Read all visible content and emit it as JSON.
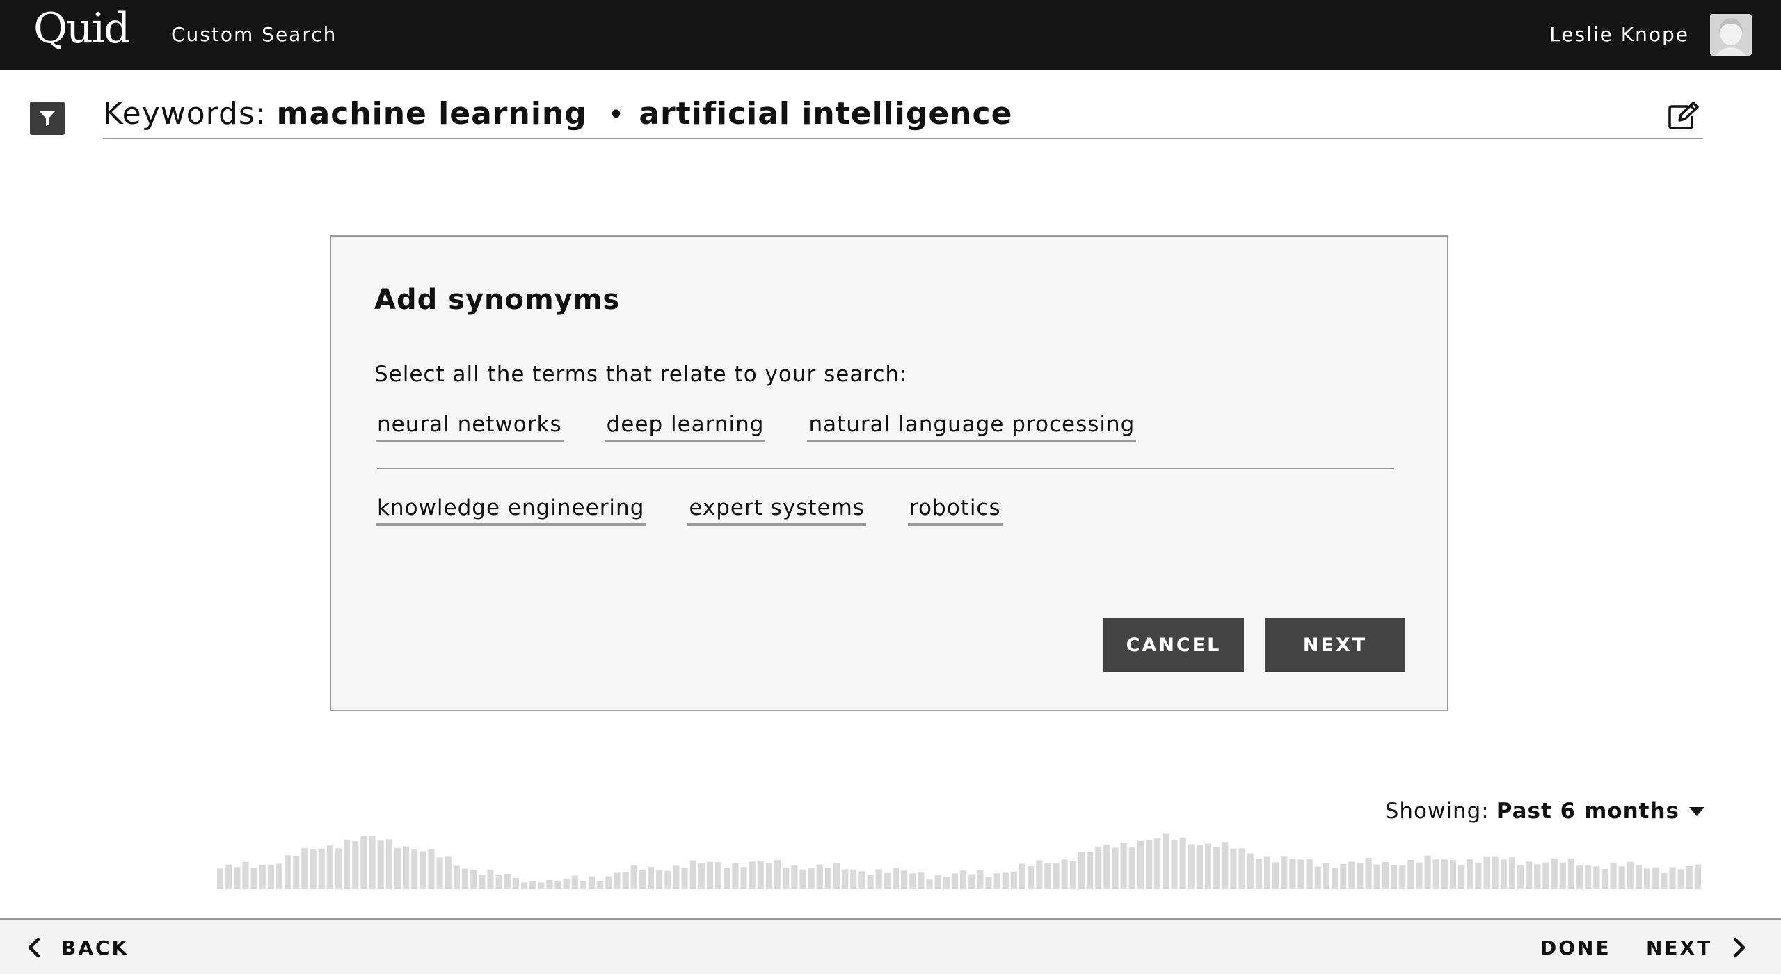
{
  "topbar": {
    "logo": "Quid",
    "app_title": "Custom Search",
    "user_name": "Leslie Knope"
  },
  "keywords": {
    "prefix": "Keywords:",
    "terms": [
      "machine learning",
      "artificial intelligence"
    ],
    "separator": "•"
  },
  "modal": {
    "title": "Add synomyms",
    "instruction": "Select all the terms that relate to your search:",
    "suggested_terms": [
      "neural networks",
      "deep learning",
      "natural language processing"
    ],
    "more_terms": [
      "knowledge engineering",
      "expert systems",
      "robotics"
    ],
    "cancel_label": "CANCEL",
    "next_label": "NEXT"
  },
  "timeline": {
    "showing_label": "Showing:",
    "range_value": "Past 6 months"
  },
  "bottom_nav": {
    "back_label": "BACK",
    "done_label": "DONE",
    "next_label": "NEXT"
  },
  "colors": {
    "topbar": "#141414",
    "button": "#444444",
    "histogram_bar": "#d9d9d9",
    "modal_bg": "#f6f6f6"
  },
  "icons": [
    "filter-icon",
    "edit-icon",
    "avatar",
    "chevron-left-icon",
    "chevron-right-icon",
    "caret-down-icon"
  ]
}
